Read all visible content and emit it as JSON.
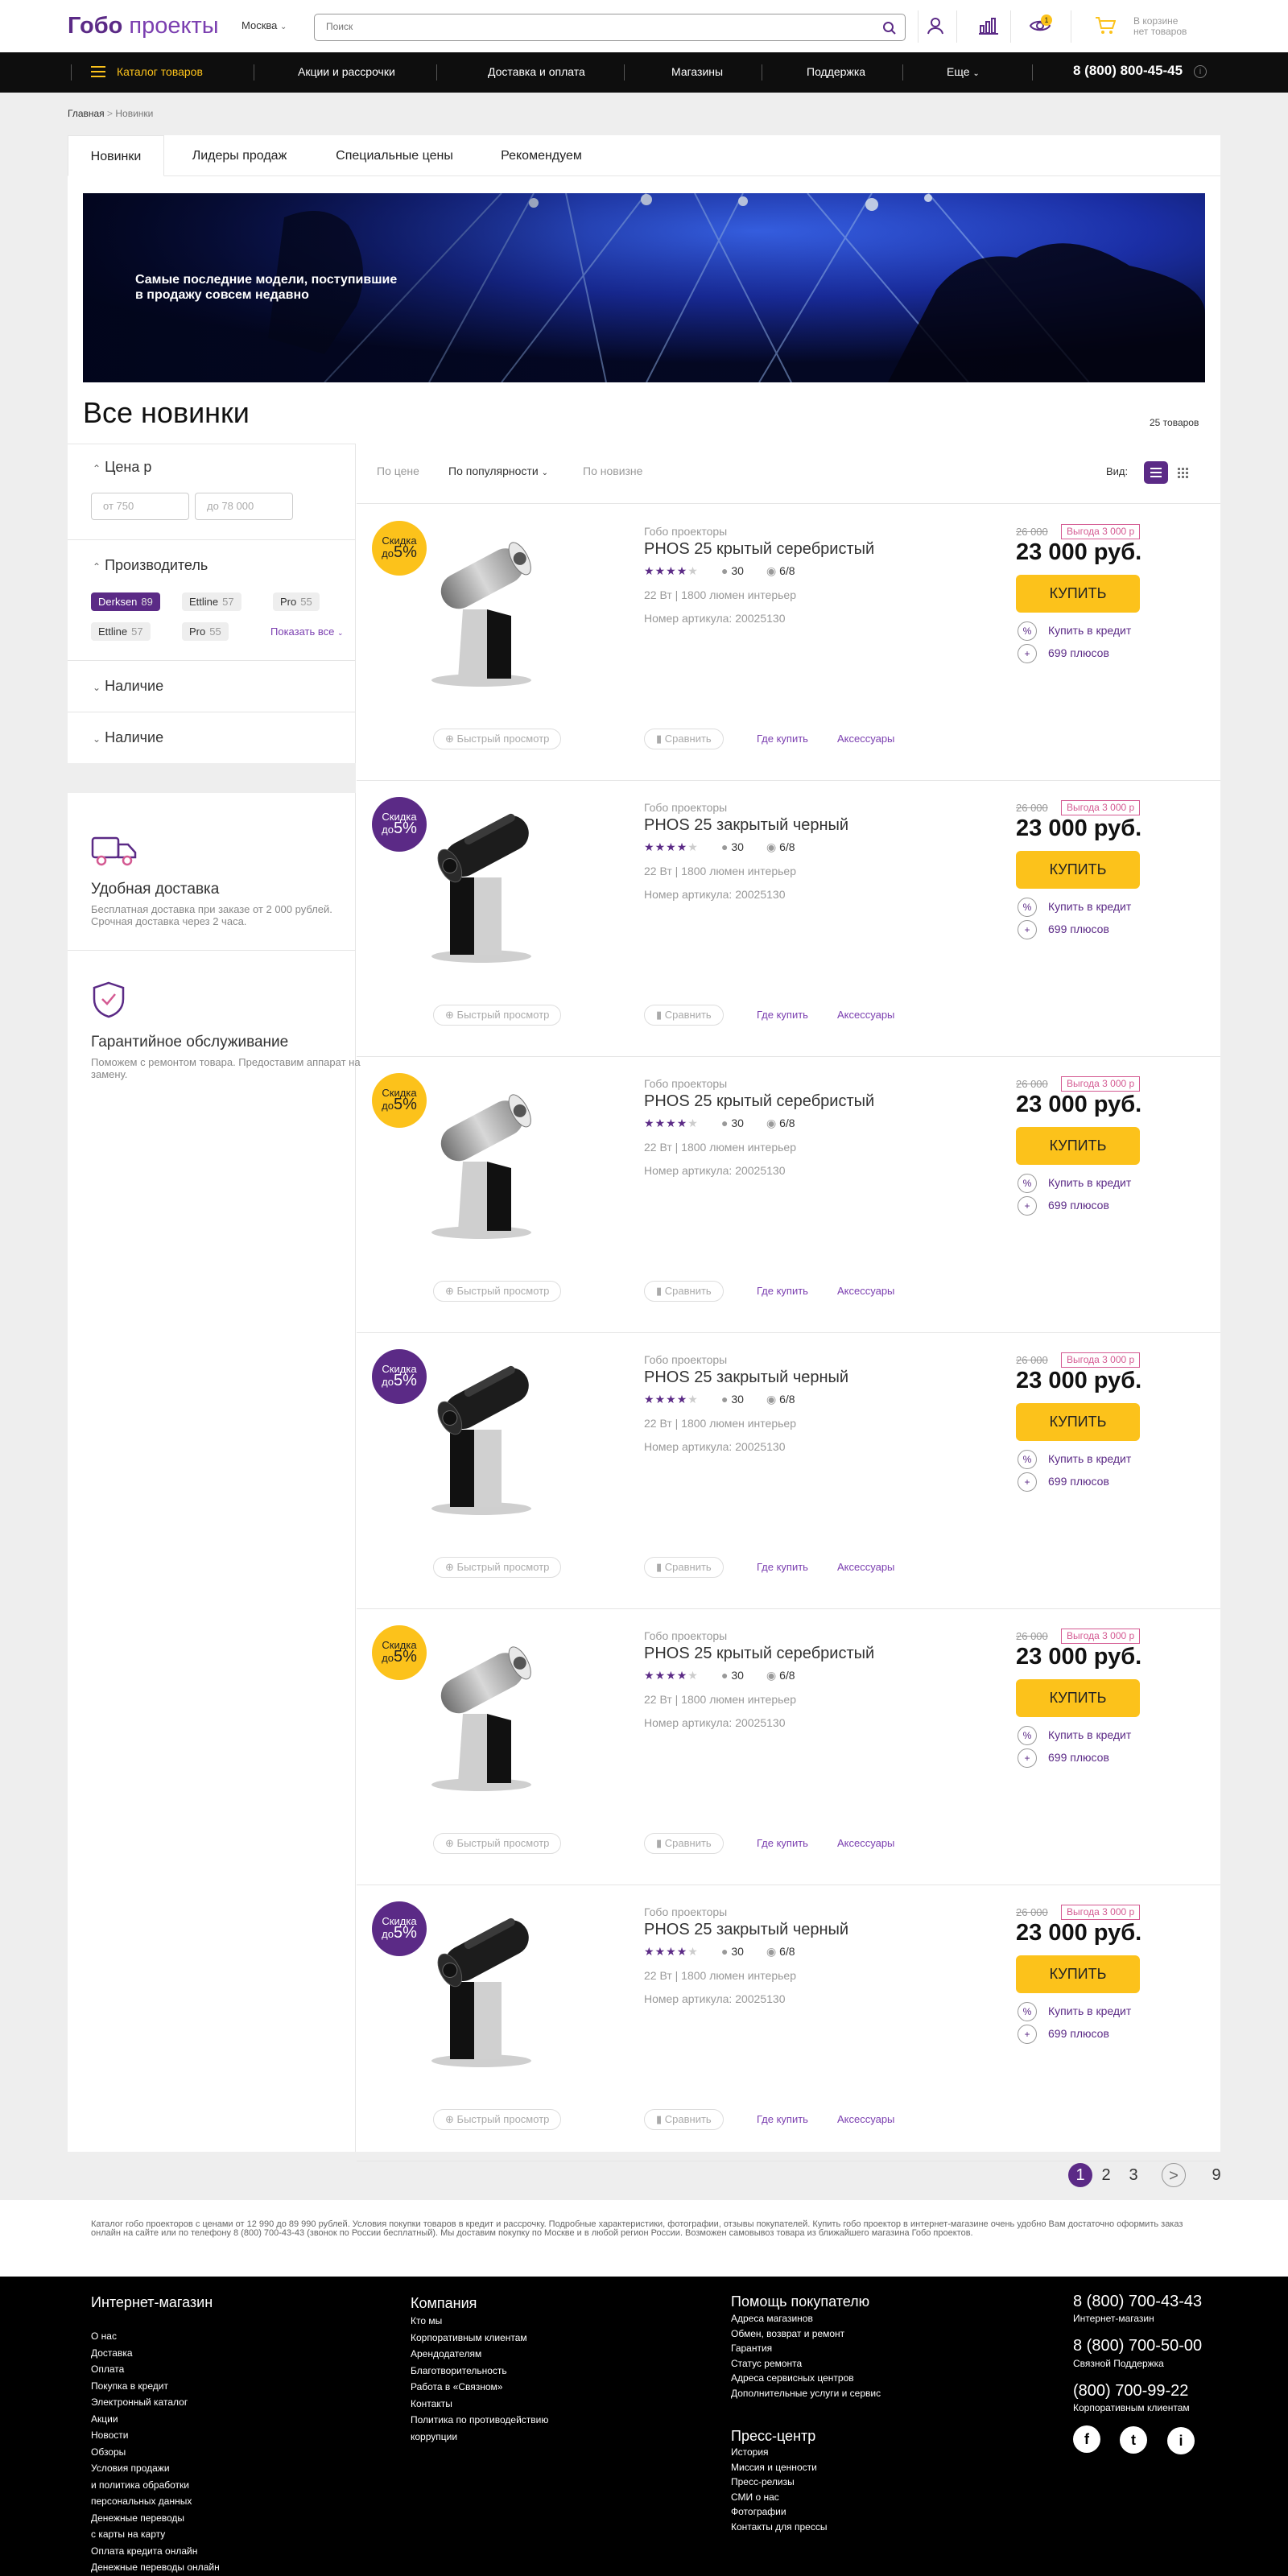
{
  "header": {
    "logo_bold": "Гобо",
    "logo_light": "проекты",
    "city": "Москва",
    "search_placeholder": "Поиск",
    "compare_count": "1",
    "cart_line1": "В корзине",
    "cart_line2": "нет товаров"
  },
  "nav": {
    "catalog": "Каталог товаров",
    "items": [
      "Акции и рассрочки",
      "Доставка и оплата",
      "Магазины",
      "Поддержка",
      "Еще"
    ],
    "phone": "8 (800) 800-45-45"
  },
  "breadcrumb": {
    "home": "Главная",
    "current": "Новинки"
  },
  "tabs": [
    "Новинки",
    "Лидеры продаж",
    "Специальные цены",
    "Рекомендуем"
  ],
  "banner": {
    "text": "Самые последние модели, поступившие в продажу совсем недавно"
  },
  "page": {
    "title": "Все новинки",
    "count": "25 товаров"
  },
  "filters": {
    "price_title": "Цена р",
    "price_from": "от   750",
    "price_to": "до   78 000",
    "maker_title": "Производитель",
    "chips": [
      {
        "name": "Derksen",
        "count": "89"
      },
      {
        "name": "Ettline",
        "count": "57"
      },
      {
        "name": "Pro",
        "count": "55"
      },
      {
        "name": "Ettline",
        "count": "57"
      },
      {
        "name": "Pro",
        "count": "55"
      }
    ],
    "show_all": "Показать все",
    "avail1": "Наличие",
    "avail2": "Наличие"
  },
  "benefits": [
    {
      "title": "Удобная доставка",
      "text": "Бесплатная доставка при заказе от 2 000 рублей. Срочная доставка через 2 часа."
    },
    {
      "title": "Гарантийное обслуживание",
      "text": "Поможем с ремонтом товара. Предоставим аппарат на замену."
    }
  ],
  "sort": {
    "by_price": "По цене",
    "by_popularity": "По популярности",
    "by_new": "По новизне",
    "view_label": "Вид:"
  },
  "products": [
    {
      "variant": "silver",
      "disc_color": "#fcc21b",
      "disc_top": "Скидка",
      "disc_small": "до",
      "disc_big": "5%",
      "brand": "Гобо проекторы",
      "name": "PHOS 25 крытый серебристый",
      "rating": 4,
      "reviews": "30",
      "views": "6/8",
      "specs": "22 Вт | 1800 люмен интерьер",
      "article": "Номер артикула: 20025130",
      "old_price": "26 000",
      "benefit": "Выгода 3 000 р",
      "price": "23 000 руб.",
      "buy": "КУПИТЬ",
      "credit": "Купить в кредит",
      "plus": "699 плюсов",
      "quick": "Быстрый просмотр",
      "compare": "Сравнить",
      "where": "Где купить",
      "acc": "Аксессуары"
    },
    {
      "variant": "black",
      "disc_color": "#5b2a86",
      "disc_top": "Скидка",
      "disc_small": "до",
      "disc_big": "5%",
      "brand": "Гобо проекторы",
      "name": "PHOS 25 закрытый черный",
      "rating": 4,
      "reviews": "30",
      "views": "6/8",
      "specs": "22 Вт | 1800 люмен интерьер",
      "article": "Номер артикула: 20025130",
      "old_price": "26 000",
      "benefit": "Выгода 3 000 р",
      "price": "23 000 руб.",
      "buy": "КУПИТЬ",
      "credit": "Купить в кредит",
      "plus": "699 плюсов",
      "quick": "Быстрый просмотр",
      "compare": "Сравнить",
      "where": "Где купить",
      "acc": "Аксессуары"
    },
    {
      "variant": "silver",
      "disc_color": "#fcc21b",
      "disc_top": "Скидка",
      "disc_small": "до",
      "disc_big": "5%",
      "brand": "Гобо проекторы",
      "name": "PHOS 25 крытый серебристый",
      "rating": 4,
      "reviews": "30",
      "views": "6/8",
      "specs": "22 Вт | 1800 люмен интерьер",
      "article": "Номер артикула: 20025130",
      "old_price": "26 000",
      "benefit": "Выгода 3 000 р",
      "price": "23 000 руб.",
      "buy": "КУПИТЬ",
      "credit": "Купить в кредит",
      "plus": "699 плюсов",
      "quick": "Быстрый просмотр",
      "compare": "Сравнить",
      "where": "Где купить",
      "acc": "Аксессуары"
    },
    {
      "variant": "black",
      "disc_color": "#5b2a86",
      "disc_top": "Скидка",
      "disc_small": "до",
      "disc_big": "5%",
      "brand": "Гобо проекторы",
      "name": "PHOS 25 закрытый черный",
      "rating": 4,
      "reviews": "30",
      "views": "6/8",
      "specs": "22 Вт | 1800 люмен интерьер",
      "article": "Номер артикула: 20025130",
      "old_price": "26 000",
      "benefit": "Выгода 3 000 р",
      "price": "23 000 руб.",
      "buy": "КУПИТЬ",
      "credit": "Купить в кредит",
      "plus": "699 плюсов",
      "quick": "Быстрый просмотр",
      "compare": "Сравнить",
      "where": "Где купить",
      "acc": "Аксессуары"
    },
    {
      "variant": "silver",
      "disc_color": "#fcc21b",
      "disc_top": "Скидка",
      "disc_small": "до",
      "disc_big": "5%",
      "brand": "Гобо проекторы",
      "name": "PHOS 25 крытый серебристый",
      "rating": 4,
      "reviews": "30",
      "views": "6/8",
      "specs": "22 Вт | 1800 люмен интерьер",
      "article": "Номер артикула: 20025130",
      "old_price": "26 000",
      "benefit": "Выгода 3 000 р",
      "price": "23 000 руб.",
      "buy": "КУПИТЬ",
      "credit": "Купить в кредит",
      "plus": "699 плюсов",
      "quick": "Быстрый просмотр",
      "compare": "Сравнить",
      "where": "Где купить",
      "acc": "Аксессуары"
    },
    {
      "variant": "black",
      "disc_color": "#5b2a86",
      "disc_top": "Скидка",
      "disc_small": "до",
      "disc_big": "5%",
      "brand": "Гобо проекторы",
      "name": "PHOS 25 закрытый черный",
      "rating": 4,
      "reviews": "30",
      "views": "6/8",
      "specs": "22 Вт | 1800 люмен интерьер",
      "article": "Номер артикула: 20025130",
      "old_price": "26 000",
      "benefit": "Выгода 3 000 р",
      "price": "23 000 руб.",
      "buy": "КУПИТЬ",
      "credit": "Купить в кредит",
      "plus": "699 плюсов",
      "quick": "Быстрый просмотр",
      "compare": "Сравнить",
      "where": "Где купить",
      "acc": "Аксессуары"
    }
  ],
  "pagination": [
    "1",
    "2",
    "3",
    ">",
    "9"
  ],
  "seo": "Каталог гобо проекторов с ценами от 12 990 до 89 990 рублей. Условия покупки товаров в кредит и рассрочку. Подробные характеристики, фотографии, отзывы покупателей. Купить гобо проектор в интернет-магазине очень удобно Вам достаточно оформить заказ онлайн на сайте или по телефону 8 (800) 700-43-43 (звонок по России бесплатный). Мы доставим покупку по Москве и в любой регион России. Возможен самовывоз товара из ближайшего магазина Гобо проектов.",
  "footer": {
    "shop": {
      "title": "Интернет-магазин",
      "links": [
        "О нас",
        "Доставка",
        "Оплата",
        "Покупка в кредит",
        "Электронный каталог",
        "Акции",
        "Новости",
        "Обзоры",
        "Условия продажи",
        "и политика обработки",
        "персональных данных",
        "Денежные переводы",
        "с карты на карту",
        "Оплата кредита онлайн",
        "Денежные переводы онлайн"
      ]
    },
    "company": {
      "title": "Компания",
      "links": [
        "Кто мы",
        "Корпоративным клиентам",
        "Арендодателям",
        "Благотворительность",
        "Работа в «Связном»",
        "Контакты",
        "Политика по противодействию",
        "коррупции"
      ]
    },
    "help": {
      "title": "Помощь покупателю",
      "links": [
        "Адреса магазинов",
        "Обмен, возврат и ремонт",
        "Гарантия",
        "Статус ремонта",
        "Адреса сервисных центров",
        "Дополнительные услуги и сервис"
      ]
    },
    "press": {
      "title": "Пресс-центр",
      "links": [
        "История",
        "Миссия и ценности",
        "Пресс-релизы",
        "СМИ о нас",
        "Фотографии",
        "Контакты для прессы"
      ]
    },
    "phones": [
      {
        "number": "8 (800) 700-43-43",
        "caption": "Интернет-магазин"
      },
      {
        "number": "8 (800) 700-50-00",
        "caption": "Связной Поддержка"
      },
      {
        "number": "(800) 700-99-22",
        "caption": "Корпоративным клиентам"
      }
    ],
    "social": [
      "f",
      "t",
      "i"
    ]
  }
}
